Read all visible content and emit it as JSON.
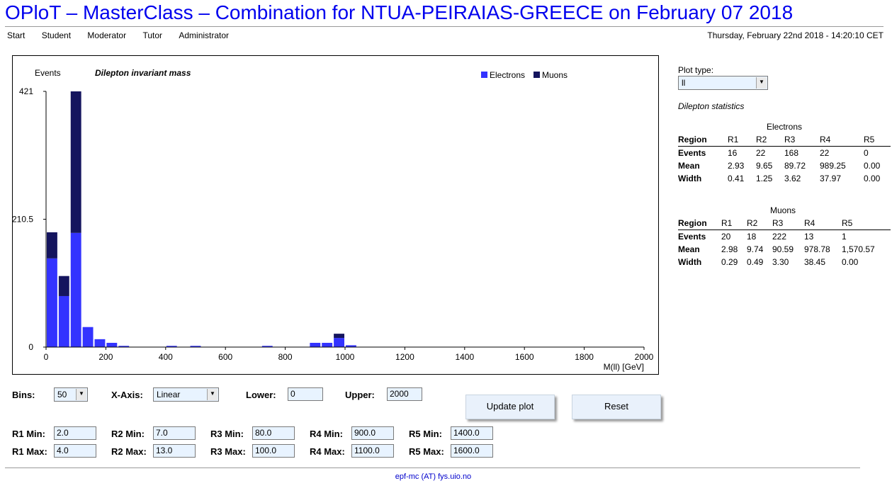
{
  "header": {
    "title": "OPloT – MasterClass – Combination for NTUA-PEIRAIAS-GREECE on February 07 2018",
    "nav": [
      "Start",
      "Student",
      "Moderator",
      "Tutor",
      "Administrator"
    ],
    "datetime": "Thursday, February 22nd 2018 - 14:20:10 CET"
  },
  "chart_data": {
    "type": "bar",
    "stacked": true,
    "title": "Dilepton invariant mass",
    "ylabel": "Events",
    "xlabel": "M(ll) [GeV]",
    "xlim": [
      0,
      2000
    ],
    "ylim": [
      0,
      421
    ],
    "yticks": [
      "0",
      "210.5",
      "421"
    ],
    "xticks": [
      "0",
      "200",
      "400",
      "600",
      "800",
      "1000",
      "1200",
      "1400",
      "1600",
      "1800",
      "2000"
    ],
    "bin_width": 40,
    "legend_position": "top-right",
    "colors": {
      "Electrons": "#3333ff",
      "Muons": "#15155e"
    },
    "bins": [
      0,
      40,
      80,
      120,
      160,
      200,
      240,
      400,
      480,
      720,
      880,
      920,
      960,
      1000
    ],
    "series": [
      {
        "name": "Electrons",
        "values": [
          146,
          84,
          188,
          33,
          13,
          7,
          2,
          2,
          2,
          2,
          7,
          7,
          15,
          3
        ]
      },
      {
        "name": "Muons",
        "values": [
          43,
          33,
          233,
          0,
          0,
          0,
          0,
          0,
          0,
          0,
          0,
          0,
          7,
          0
        ]
      }
    ]
  },
  "sidebar": {
    "plot_type_label": "Plot type:",
    "plot_type_value": "ll",
    "stats_label": "Dilepton statistics",
    "electrons": {
      "caption": "Electrons",
      "headers": [
        "Region",
        "R1",
        "R2",
        "R3",
        "R4",
        "R5"
      ],
      "rows": [
        [
          "Events",
          "16",
          "22",
          "168",
          "22",
          "0"
        ],
        [
          "Mean",
          "2.93",
          "9.65",
          "89.72",
          "989.25",
          "0.00"
        ],
        [
          "Width",
          "0.41",
          "1.25",
          "3.62",
          "37.97",
          "0.00"
        ]
      ]
    },
    "muons": {
      "caption": "Muons",
      "headers": [
        "Region",
        "R1",
        "R2",
        "R3",
        "R4",
        "R5"
      ],
      "rows": [
        [
          "Events",
          "20",
          "18",
          "222",
          "13",
          "1"
        ],
        [
          "Mean",
          "2.98",
          "9.74",
          "90.59",
          "978.78",
          "1,570.57"
        ],
        [
          "Width",
          "0.29",
          "0.49",
          "3.30",
          "38.45",
          "0.00"
        ]
      ]
    }
  },
  "controls": {
    "bins_label": "Bins:",
    "bins_value": "50",
    "xaxis_label": "X-Axis:",
    "xaxis_value": "Linear",
    "lower_label": "Lower:",
    "lower_value": "0",
    "upper_label": "Upper:",
    "upper_value": "2000",
    "update_button": "Update plot",
    "reset_button": "Reset",
    "regions": [
      {
        "min_label": "R1 Min:",
        "min_value": "2.0",
        "max_label": "R1 Max:",
        "max_value": "4.0"
      },
      {
        "min_label": "R2 Min:",
        "min_value": "7.0",
        "max_label": "R2 Max:",
        "max_value": "13.0"
      },
      {
        "min_label": "R3 Min:",
        "min_value": "80.0",
        "max_label": "R3 Max:",
        "max_value": "100.0"
      },
      {
        "min_label": "R4 Min:",
        "min_value": "900.0",
        "max_label": "R4 Max:",
        "max_value": "1100.0"
      },
      {
        "min_label": "R5 Min:",
        "min_value": "1400.0",
        "max_label": "R5 Max:",
        "max_value": "1600.0"
      }
    ]
  },
  "footer": {
    "text": "epf-mc (AT) fys.uio.no"
  }
}
